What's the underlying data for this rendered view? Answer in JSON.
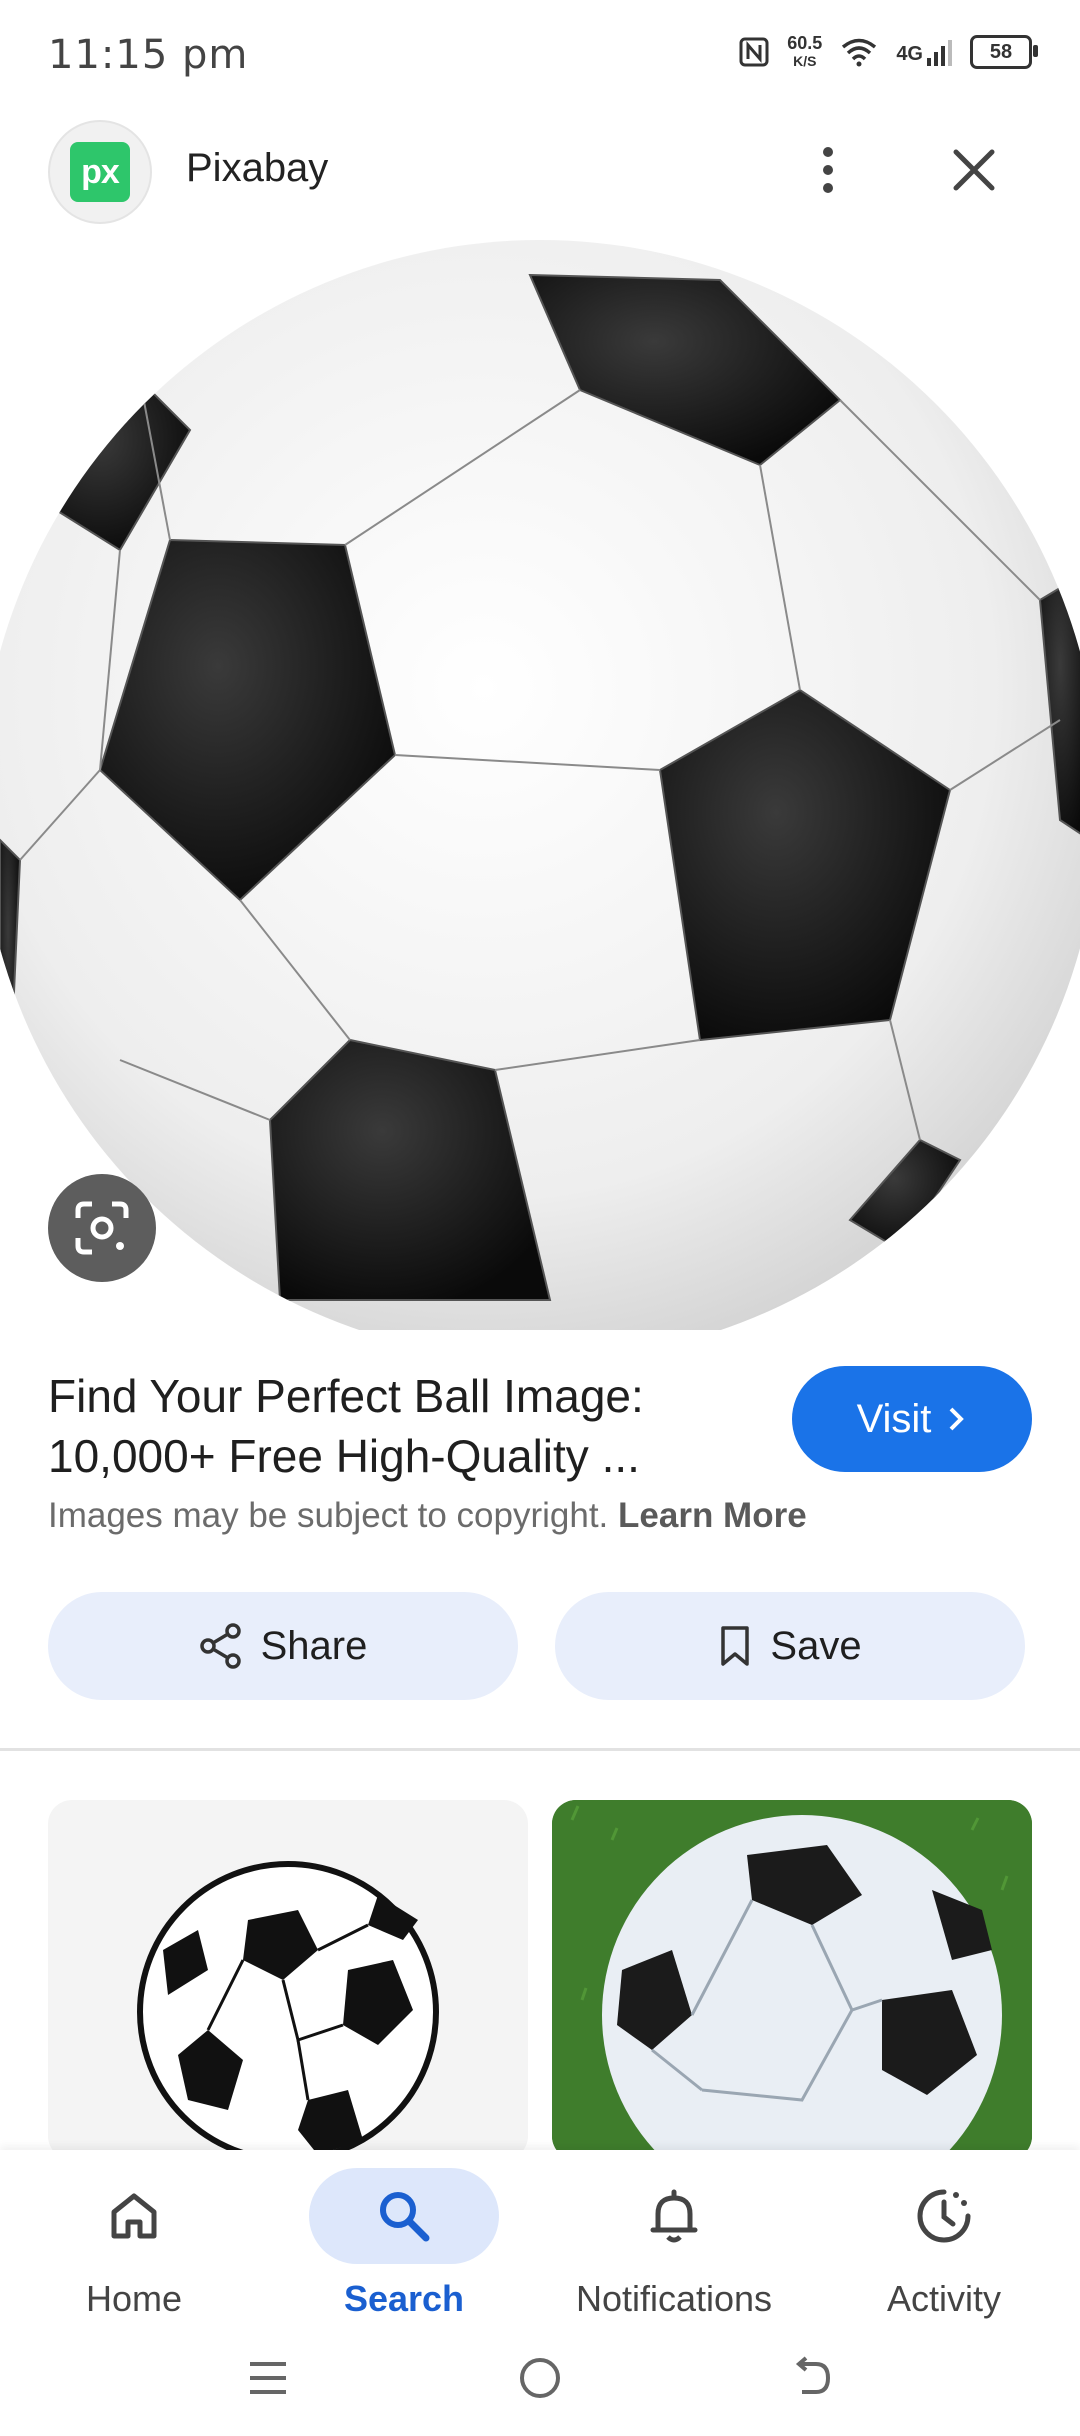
{
  "status_bar": {
    "time": "11:15 pm",
    "speed_value": "60.5",
    "speed_unit": "K/S",
    "network": "4G",
    "battery": "58"
  },
  "header": {
    "logo_text": "px",
    "site_name": "Pixabay"
  },
  "result": {
    "title_line1": "Find Your Perfect Ball Image:",
    "title_line2": "10,000+ Free High-Quality ...",
    "visit_label": "Visit",
    "copyright_text": "Images may be subject to copyright.",
    "learn_more": "Learn More"
  },
  "actions": {
    "share_label": "Share",
    "save_label": "Save"
  },
  "bottom_nav": {
    "items": [
      {
        "label": "Home",
        "icon": "home-icon"
      },
      {
        "label": "Search",
        "icon": "search-icon",
        "active": true
      },
      {
        "label": "Notifications",
        "icon": "bell-icon"
      },
      {
        "label": "Activity",
        "icon": "activity-icon"
      }
    ]
  },
  "colors": {
    "accent": "#1a73e8",
    "pill_bg": "#e8eefb",
    "logo_green": "#2ec66b"
  }
}
